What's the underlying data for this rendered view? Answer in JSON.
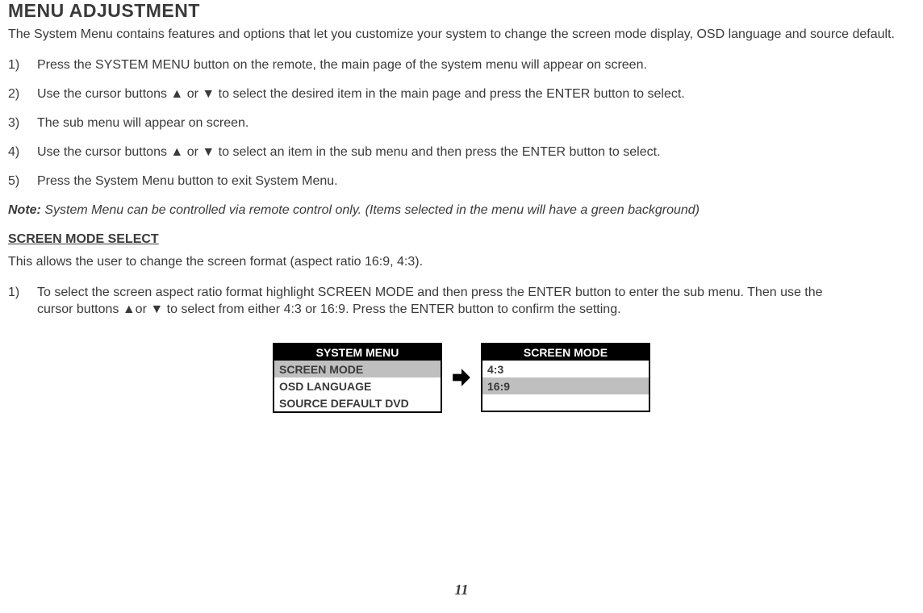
{
  "title": "MENU ADJUSTMENT",
  "intro": "The System Menu contains features and options that let you customize your system to change the screen mode display, OSD language and source default.",
  "steps": [
    {
      "n": "1)",
      "t": "Press the SYSTEM MENU button on the remote, the main page of the system menu will appear on screen."
    },
    {
      "n": "2)",
      "t": "Use the cursor buttons ▲ or ▼ to select the desired item in the main page and press the ENTER button to select."
    },
    {
      "n": "3)",
      "t": "The sub menu will appear on screen."
    },
    {
      "n": "4)",
      "t": "Use the cursor buttons ▲ or ▼ to select an item in the sub menu and then press the ENTER button to select."
    },
    {
      "n": "5)",
      "t": "Press the System Menu button to exit System Menu."
    }
  ],
  "note": {
    "label": "Note:",
    "text": " System Menu can be controlled via remote control only. (Items selected in the menu will have a green background)"
  },
  "subheading": "SCREEN MODE SELECT",
  "desc": "This allows the user to change the screen format (aspect ratio 16:9, 4:3).",
  "screen_step": {
    "n": "1)",
    "line1": "To select the screen aspect ratio format highlight SCREEN MODE and then press the ENTER button to enter the sub menu. Then use the",
    "line2": "cursor buttons ▲or ▼ to select from either 4:3 or 16:9. Press the ENTER button to confirm the setting."
  },
  "menus": {
    "system": {
      "header": "SYSTEM MENU",
      "items": [
        {
          "label": "SCREEN MODE",
          "selected": true
        },
        {
          "label": "OSD LANGUAGE",
          "selected": false
        },
        {
          "label": "SOURCE DEFAULT DVD",
          "selected": false
        }
      ]
    },
    "screen": {
      "header": "SCREEN MODE",
      "items": [
        {
          "label": "4:3",
          "selected": false
        },
        {
          "label": "16:9",
          "selected": true
        },
        {
          "label": "",
          "selected": false
        }
      ]
    }
  },
  "page": "11"
}
